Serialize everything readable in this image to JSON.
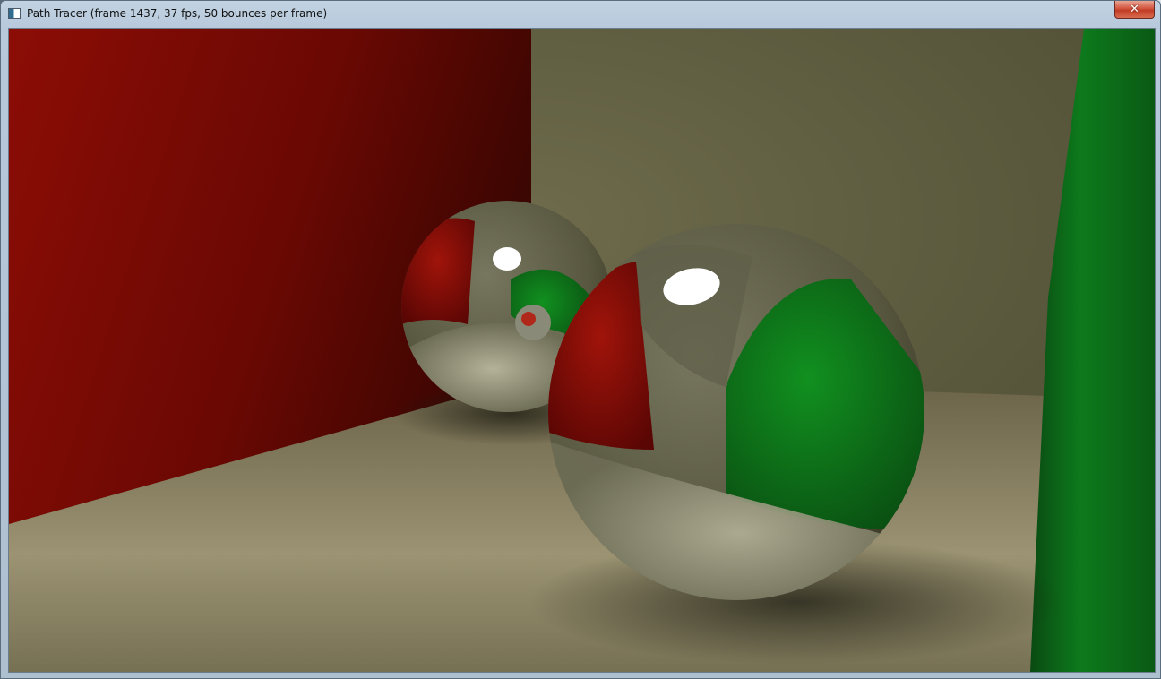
{
  "window": {
    "title": "Path Tracer (frame 1437, 37 fps, 50 bounces per frame)",
    "close_symbol": "✕"
  },
  "render": {
    "scene": "cornell-box",
    "colors": {
      "left_wall": "#7a0a04",
      "right_wall": "#0b6a16",
      "back_wall": "#5c5a3c",
      "floor": "#8f8a68",
      "sphere_base": "#6b6b55",
      "highlight": "#ffffff"
    }
  }
}
